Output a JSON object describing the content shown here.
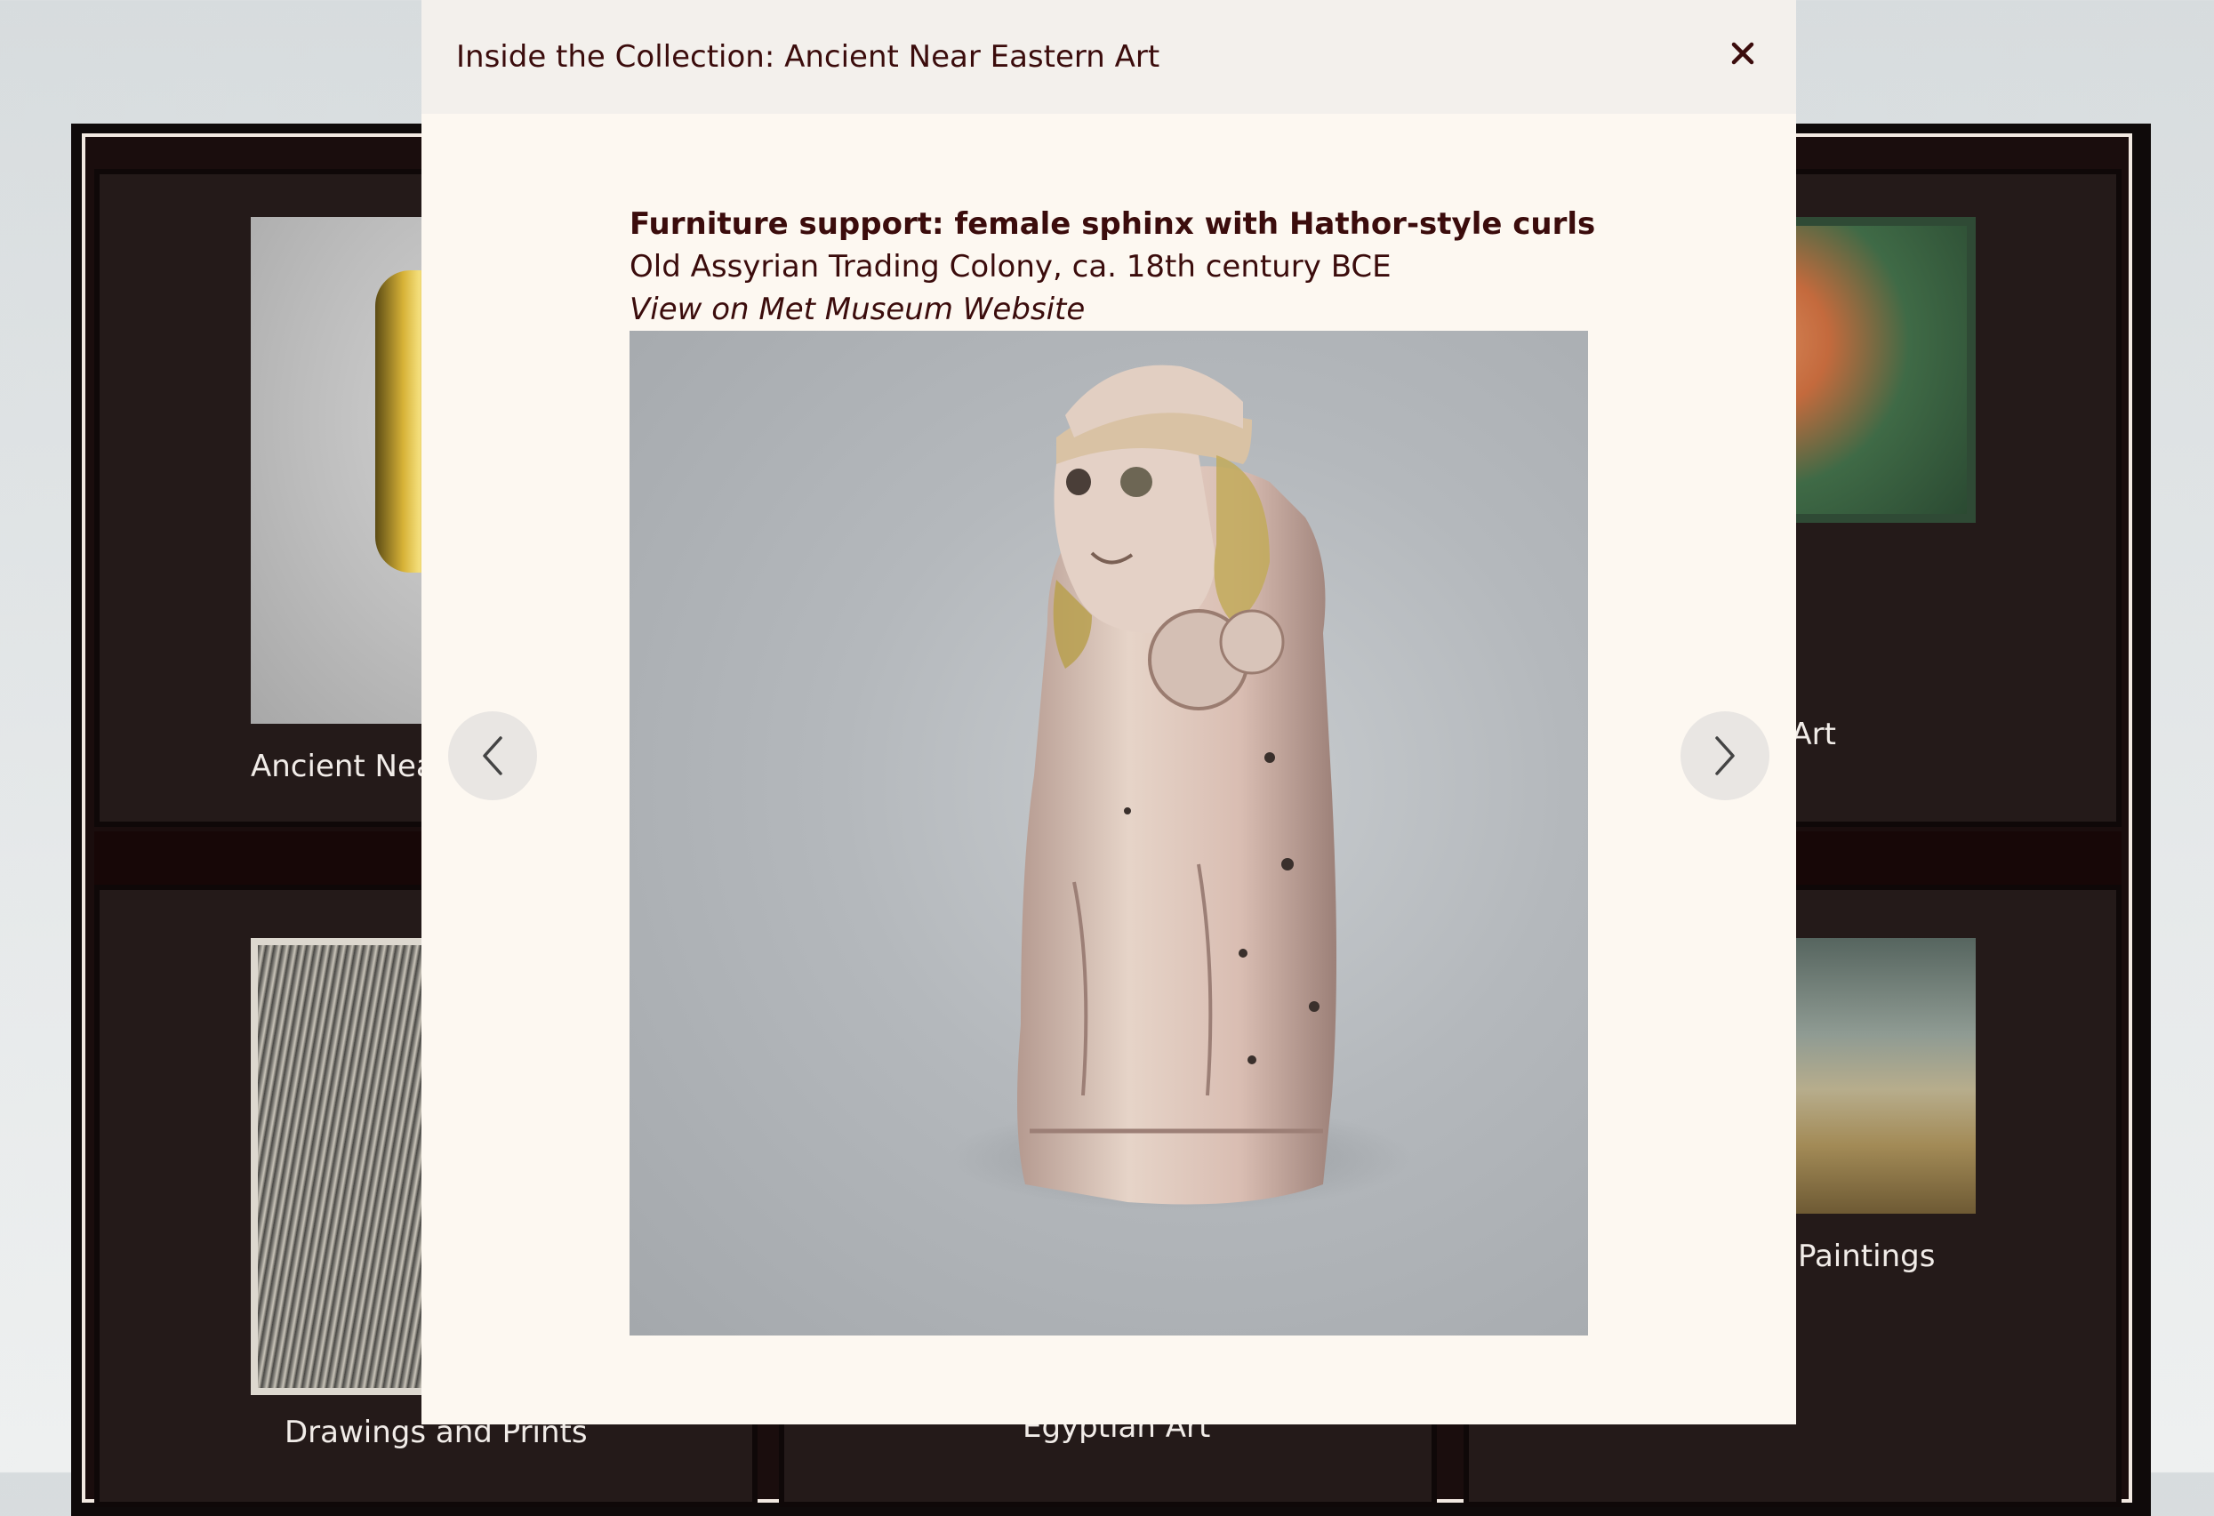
{
  "gallery": {
    "cards": [
      {
        "label": "Ancient Nea"
      },
      {
        "label": "n Art"
      },
      {
        "label": "Drawings and Prints"
      },
      {
        "label": "Egyptian Art"
      },
      {
        "label": "Paintings"
      }
    ]
  },
  "modal": {
    "title": "Inside the Collection: Ancient Near Eastern Art",
    "close_icon": "close-icon",
    "artwork": {
      "title": "Furniture support: female sphinx with Hathor-style curls",
      "subtitle": "Old Assyrian Trading Colony, ca. 18th century BCE",
      "link_text": "View on Met Museum Website"
    },
    "nav": {
      "prev_icon": "chevron-left-icon",
      "next_icon": "chevron-right-icon"
    }
  },
  "colors": {
    "accent_text": "#3b0c0c",
    "modal_bg": "#fdf8f1",
    "header_bg": "#f3f0ec",
    "gallery_bg": "#1a0d0d"
  }
}
